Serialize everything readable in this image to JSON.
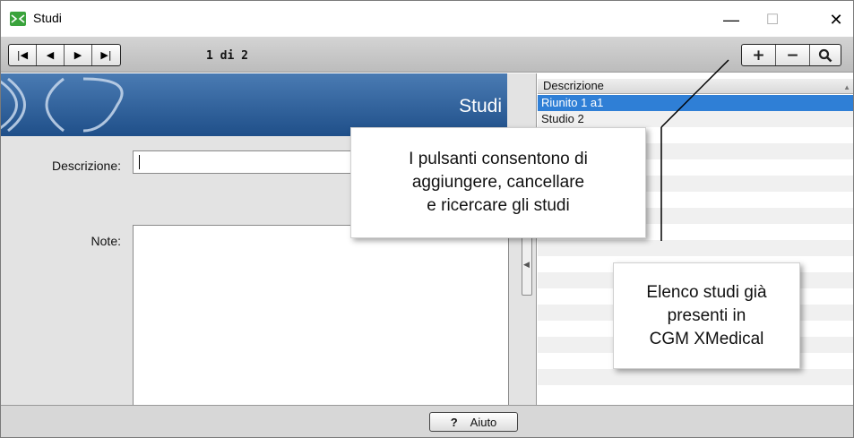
{
  "window": {
    "title": "Studi",
    "min_glyph": "—",
    "max_glyph": "☐",
    "close_glyph": "✕"
  },
  "toolbar": {
    "nav": [
      {
        "name": "first-record-button",
        "glyph": "|◀"
      },
      {
        "name": "previous-record-button",
        "glyph": "◀"
      },
      {
        "name": "next-record-button",
        "glyph": "▶"
      },
      {
        "name": "last-record-button",
        "glyph": "▶|"
      }
    ],
    "record_counter": "1 di 2",
    "actions": [
      {
        "name": "add-button",
        "glyph": "+"
      },
      {
        "name": "delete-button",
        "glyph": "−"
      },
      {
        "name": "search-button",
        "glyph": "🔍"
      }
    ]
  },
  "form": {
    "banner_title": "Studi",
    "description_label": "Descrizione:",
    "description_value": "",
    "notes_label": "Note:",
    "notes_value": ""
  },
  "list": {
    "column_header": "Descrizione",
    "rows": [
      "Riunito 1 a1",
      "Studio 2"
    ],
    "selected_index": 0
  },
  "footer": {
    "help_label": "Aiuto",
    "help_glyph": "?"
  },
  "callouts": {
    "buttons_note": "I pulsanti consentono di aggiungere, cancellare e ricercare gli studi",
    "buttons_note_lines": [
      "I pulsanti consentono di",
      "aggiungere, cancellare",
      "e ricercare gli studi"
    ],
    "list_note_lines": [
      "Elenco studi già",
      "presenti in",
      "CGM XMedical"
    ]
  }
}
